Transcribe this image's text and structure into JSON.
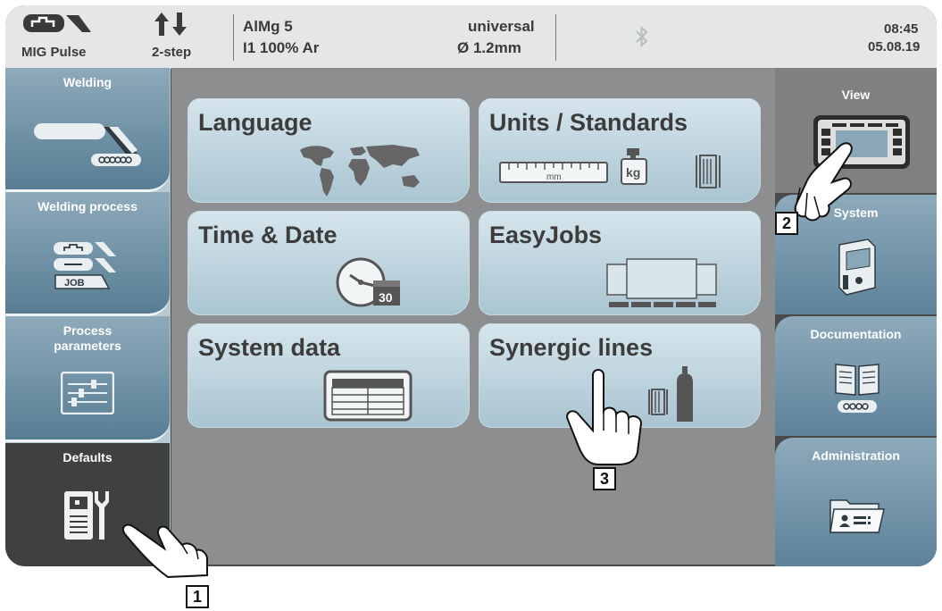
{
  "status": {
    "mode": "MIG Pulse",
    "trigger": "2-step",
    "material": "AlMg 5",
    "gas": "I1 100% Ar",
    "wire_type": "universal",
    "wire_diameter": "Ø  1.2mm",
    "time": "08:45",
    "date": "05.08.19",
    "icons": [
      "welding-mode-icon",
      "trigger-mode-icon",
      "bluetooth-icon"
    ]
  },
  "left_menu": [
    {
      "label": "Welding",
      "icon": "welding-torch-icon"
    },
    {
      "label": "Welding process",
      "icon": "process-job-icon",
      "icon_text": "JOB"
    },
    {
      "label": "Process\nparameters",
      "icon": "sliders-icon"
    },
    {
      "label": "Defaults",
      "icon": "device-wrench-icon",
      "active": true
    }
  ],
  "tiles": [
    {
      "label": "Language",
      "icon": "world-map-icon"
    },
    {
      "label": "Units / Standards",
      "icon": "units-icon",
      "ruler_text": "mm",
      "weight_text": "kg"
    },
    {
      "label": "Time & Date",
      "icon": "clock-calendar-icon",
      "calendar_text": "30"
    },
    {
      "label": "EasyJobs",
      "icon": "easyjobs-icon"
    },
    {
      "label": "System data",
      "icon": "table-icon"
    },
    {
      "label": "Synergic lines",
      "icon": "wire-gas-icon"
    }
  ],
  "right_menu": [
    {
      "label": "View",
      "icon": "display-icon",
      "active": true
    },
    {
      "label": "System",
      "icon": "power-source-icon"
    },
    {
      "label": "Documentation",
      "icon": "book-icon"
    },
    {
      "label": "Administration",
      "icon": "folder-id-icon"
    }
  ],
  "callouts": [
    "1",
    "2",
    "3"
  ],
  "colors": {
    "button_top": "#8eaabb",
    "button_bottom": "#587d93",
    "tile_top": "#d6e5ec",
    "tile_bottom": "#a9c4d1",
    "frame": "#4a4a4a",
    "panel": "#8d8e8f"
  }
}
